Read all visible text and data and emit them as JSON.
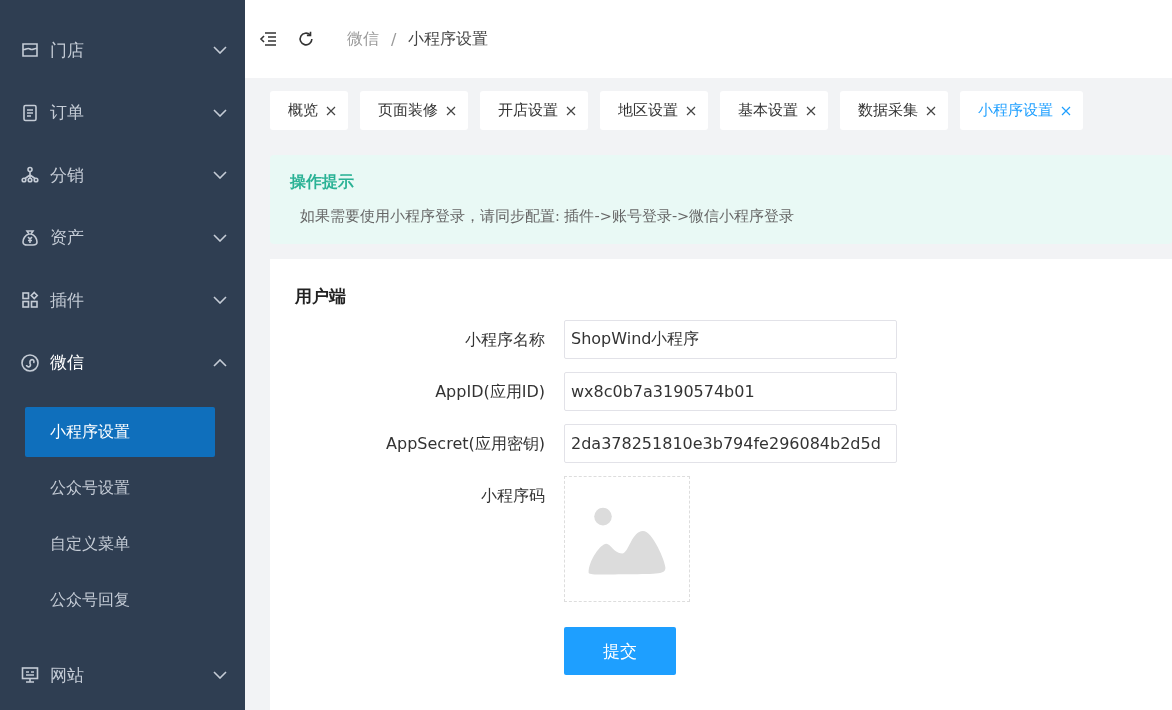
{
  "sidebar": {
    "items": [
      {
        "label": "门店",
        "kind": "store",
        "expanded": false
      },
      {
        "label": "订单",
        "kind": "document",
        "expanded": false
      },
      {
        "label": "分销",
        "kind": "network",
        "expanded": false
      },
      {
        "label": "资产",
        "kind": "moneybag",
        "expanded": false
      },
      {
        "label": "插件",
        "kind": "grid",
        "expanded": false
      },
      {
        "label": "微信",
        "kind": "miniprogram",
        "expanded": true,
        "children": [
          {
            "label": "小程序设置",
            "selected": true
          },
          {
            "label": "公众号设置",
            "selected": false
          },
          {
            "label": "自定义菜单",
            "selected": false
          },
          {
            "label": "公众号回复",
            "selected": false
          }
        ]
      },
      {
        "label": "网站",
        "kind": "monitor",
        "expanded": false
      }
    ]
  },
  "breadcrumb": {
    "separator": "/",
    "items": [
      "微信",
      "小程序设置"
    ]
  },
  "tabs": [
    {
      "label": "概览",
      "selected": false
    },
    {
      "label": "页面装修",
      "selected": false
    },
    {
      "label": "开店设置",
      "selected": false
    },
    {
      "label": "地区设置",
      "selected": false
    },
    {
      "label": "基本设置",
      "selected": false
    },
    {
      "label": "数据采集",
      "selected": false
    },
    {
      "label": "小程序设置",
      "selected": true
    }
  ],
  "tip": {
    "title": "操作提示",
    "text": "如果需要使用小程序登录，请同步配置: 插件->账号登录->微信小程序登录"
  },
  "form": {
    "section": "用户端",
    "fields": [
      {
        "kind": "text",
        "label": "小程序名称",
        "value": "ShopWind小程序"
      },
      {
        "kind": "text",
        "label": "AppID(应用ID)",
        "value": "wx8c0b7a3190574b01"
      },
      {
        "kind": "text",
        "label": "AppSecret(应用密钥)",
        "value": "2da378251810e3b794fe296084b2d5d"
      },
      {
        "kind": "image",
        "label": "小程序码"
      }
    ],
    "submit": "提交"
  }
}
